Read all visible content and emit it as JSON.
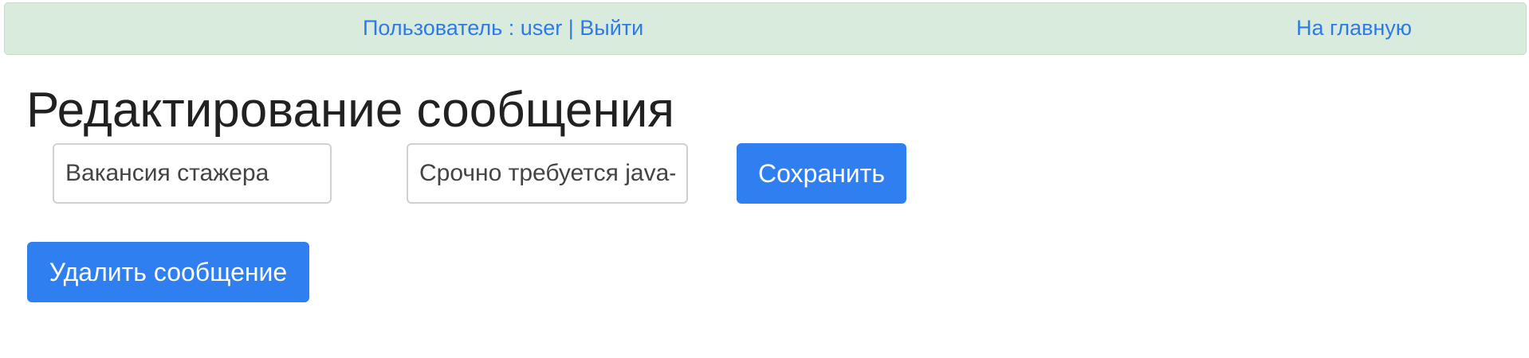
{
  "header": {
    "user_prefix": "Пользователь : ",
    "username": "user",
    "separator": " | ",
    "logout_label": "Выйти",
    "home_label": "На главную"
  },
  "page": {
    "title": "Редактирование сообщения"
  },
  "form": {
    "title_value": "Вакансия стажера",
    "text_value": "Срочно требуется java-",
    "save_label": "Сохранить"
  },
  "actions": {
    "delete_label": "Удалить сообщение"
  },
  "colors": {
    "header_bg": "#d9ebdd",
    "link": "#2f7ae5",
    "button_primary": "#2f7ff0"
  }
}
